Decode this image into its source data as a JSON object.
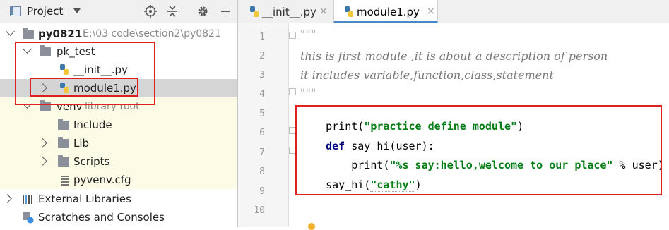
{
  "project_panel": {
    "title": "Project",
    "tree": {
      "root": {
        "name": "py0821",
        "path": "E:\\03 code\\section2\\py0821"
      },
      "pk_test": {
        "name": "pk_test"
      },
      "init_file": {
        "name": "__init__.py"
      },
      "module_file": {
        "name": "module1.py"
      },
      "venv": {
        "name": "venv",
        "note": "library root"
      },
      "include": {
        "name": "Include"
      },
      "lib": {
        "name": "Lib"
      },
      "scripts": {
        "name": "Scripts"
      },
      "pyvenv": {
        "name": "pyvenv.cfg"
      },
      "external": {
        "name": "External Libraries"
      },
      "scratches": {
        "name": "Scratches and Consoles"
      }
    }
  },
  "editor": {
    "tabs": [
      {
        "label": "__init__.py",
        "close": "×",
        "active": false
      },
      {
        "label": "module1.py",
        "close": "×",
        "active": true
      }
    ],
    "line_numbers": [
      "1",
      "2",
      "3",
      "4",
      "5",
      "6",
      "7",
      "8",
      "9",
      "10"
    ],
    "lines": {
      "l1": "\"\"\"",
      "l2": "this is first module ,it is about a description of person",
      "l3": "it includes variable,function,class,statement",
      "l4": "\"\"\"",
      "l5_fn": "print(",
      "l5_str": "\"practice define module\"",
      "l5_end": ")",
      "l6_kw": "def",
      "l6_rest": " say_hi(user):",
      "l7_fn": "    print(",
      "l7_str": "\"%s say:hello,welcome to our place\"",
      "l7_end": " % user)",
      "l8_fn": "say_hi(",
      "l8_str": "\"cathy\"",
      "l8_end": ")"
    }
  },
  "colors": {
    "highlight_box": "#e02020",
    "string": "#067d17",
    "keyword": "#000080",
    "selection": "#d5d5d5",
    "venv_bg": "#fbfbe6"
  }
}
